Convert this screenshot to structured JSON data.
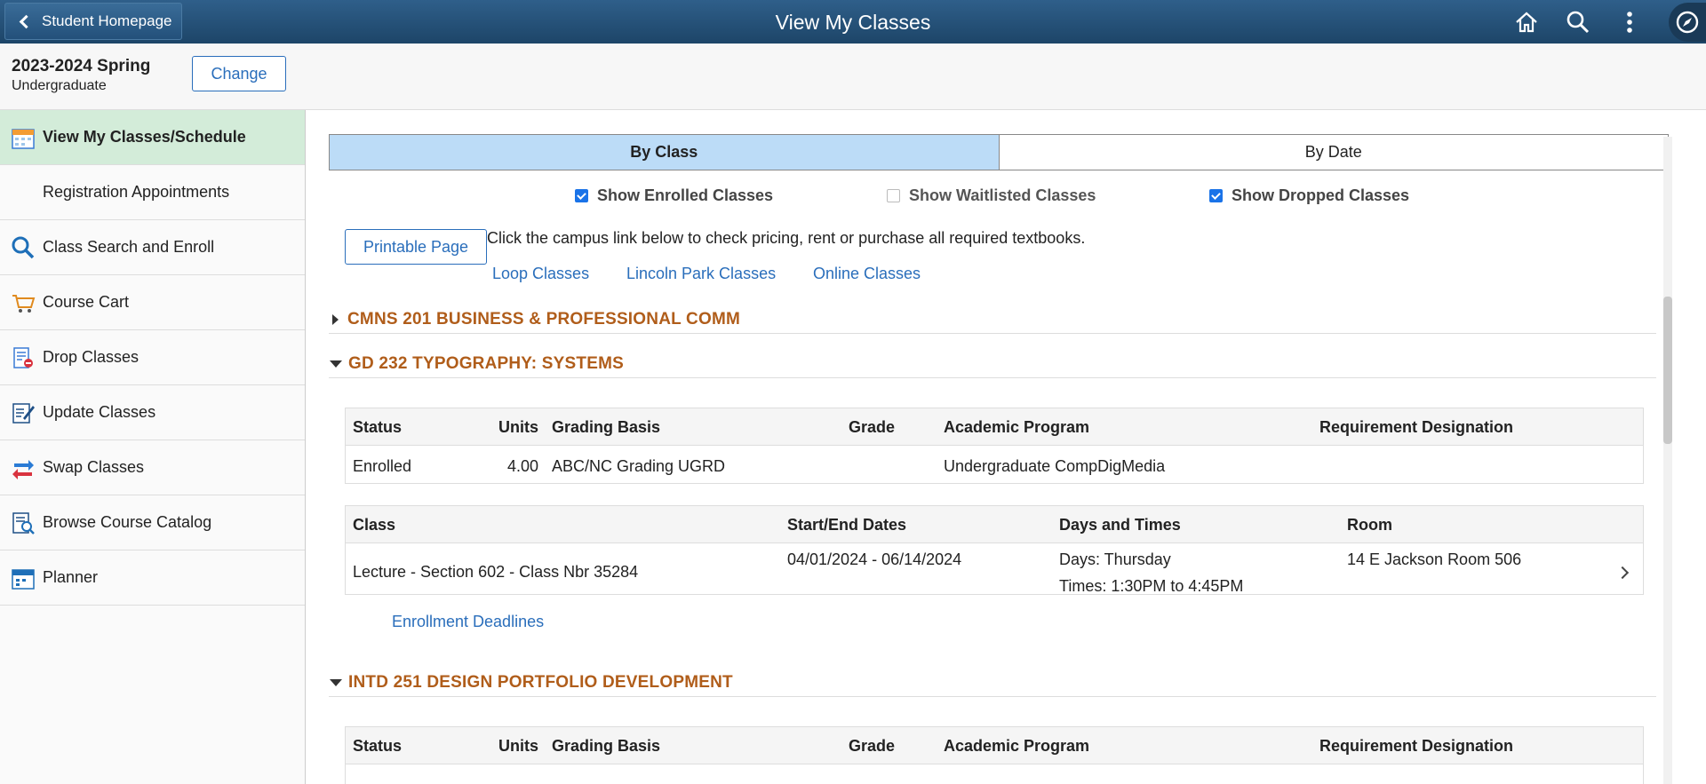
{
  "header": {
    "back_label": "Student Homepage",
    "title": "View My Classes"
  },
  "term": {
    "name": "2023-2024 Spring",
    "career": "Undergraduate",
    "change_label": "Change"
  },
  "sidebar": {
    "items": [
      {
        "label": "View My Classes/Schedule",
        "icon": "calendar-icon"
      },
      {
        "label": "Registration Appointments",
        "icon": ""
      },
      {
        "label": "Class Search and Enroll",
        "icon": "search-icon"
      },
      {
        "label": "Course Cart",
        "icon": "cart-icon"
      },
      {
        "label": "Drop Classes",
        "icon": "drop-icon"
      },
      {
        "label": "Update Classes",
        "icon": "edit-icon"
      },
      {
        "label": "Swap Classes",
        "icon": "swap-icon"
      },
      {
        "label": "Browse Course Catalog",
        "icon": "catalog-icon"
      },
      {
        "label": "Planner",
        "icon": "planner-icon"
      }
    ]
  },
  "tabs": {
    "by_class": "By Class",
    "by_date": "By Date"
  },
  "filters": {
    "enrolled": "Show Enrolled Classes",
    "waitlisted": "Show Waitlisted Classes",
    "dropped": "Show Dropped Classes"
  },
  "printable_label": "Printable Page",
  "textbook_info": "Click the campus link below to check pricing, rent or purchase all required textbooks.",
  "campus_links": {
    "loop": "Loop Classes",
    "lincoln": "Lincoln Park Classes",
    "online": "Online Classes"
  },
  "grid_headers": {
    "status": "Status",
    "units": "Units",
    "grading": "Grading Basis",
    "grade": "Grade",
    "program": "Academic Program",
    "requirement": "Requirement Designation",
    "class": "Class",
    "dates": "Start/End Dates",
    "days_times": "Days and Times",
    "room": "Room"
  },
  "courses": [
    {
      "title": "CMNS 201 BUSINESS & PROFESSIONAL COMM",
      "expanded": false
    },
    {
      "title": "GD 232 TYPOGRAPHY: SYSTEMS",
      "expanded": true,
      "status": "Enrolled",
      "units": "4.00",
      "grading": "ABC/NC Grading UGRD",
      "grade": "",
      "program": "Undergraduate CompDigMedia",
      "requirement": "",
      "class": "Lecture - Section 602 - Class Nbr 35284",
      "dates": "04/01/2024 - 06/14/2024",
      "days": "Days: Thursday",
      "times": "Times: 1:30PM to 4:45PM",
      "room": "14 E Jackson Room 506",
      "deadlines": "Enrollment Deadlines"
    },
    {
      "title": "INTD 251 DESIGN PORTFOLIO DEVELOPMENT",
      "expanded": true
    }
  ]
}
